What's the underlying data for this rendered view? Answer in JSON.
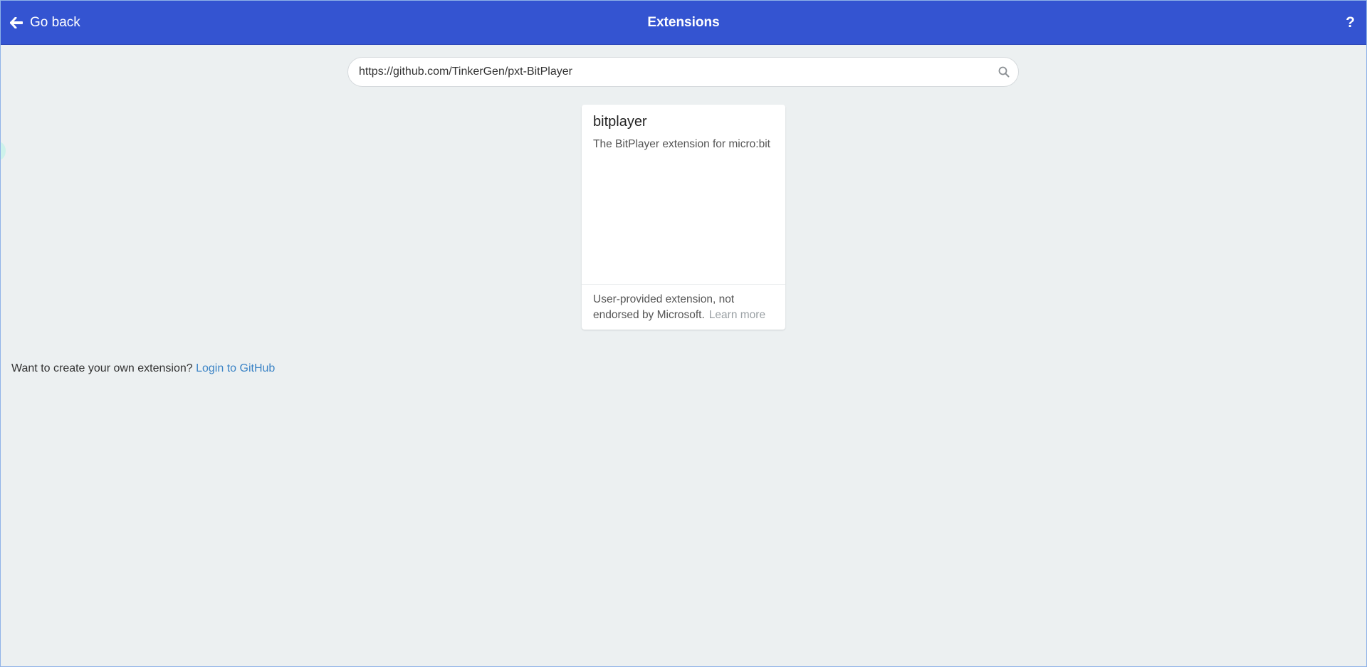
{
  "header": {
    "back_label": "Go back",
    "title": "Extensions",
    "help_label": "?"
  },
  "search": {
    "value": "https://github.com/TinkerGen/pxt-BitPlayer",
    "icon": "search-icon"
  },
  "results": [
    {
      "title": "bitplayer",
      "description": "The BitPlayer extension for micro:bit",
      "footer_text": "User-provided extension, not endorsed by Microsoft.",
      "learn_more": "Learn more"
    }
  ],
  "create_prompt": {
    "text": "Want to create your own extension?",
    "link": "Login to GitHub"
  },
  "colors": {
    "header_bg": "#3454d1",
    "page_bg": "#ecf0f1",
    "link": "#3c84c6"
  }
}
